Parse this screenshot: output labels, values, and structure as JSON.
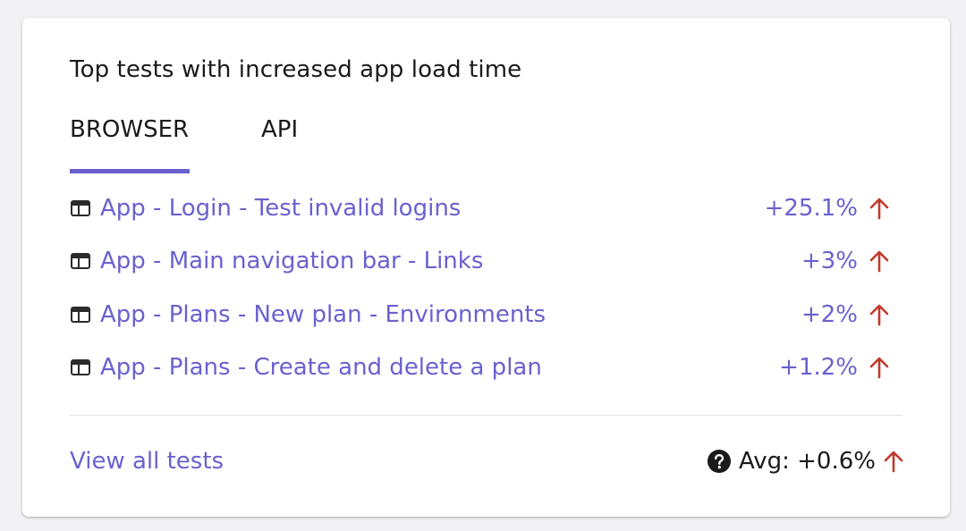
{
  "card": {
    "title": "Top tests with increased app load time",
    "tabs": [
      {
        "label": "BROWSER",
        "active": true
      },
      {
        "label": "API",
        "active": false
      }
    ],
    "rows": [
      {
        "icon": "browser-window-icon",
        "name": "App - Login - Test invalid logins",
        "change": "+25.1%",
        "trend": "up"
      },
      {
        "icon": "browser-window-icon",
        "name": "App - Main navigation bar - Links",
        "change": "+3%",
        "trend": "up"
      },
      {
        "icon": "browser-window-icon",
        "name": "App - Plans - New plan - Environments",
        "change": "+2%",
        "trend": "up"
      },
      {
        "icon": "browser-window-icon",
        "name": "App - Plans - Create and delete a plan",
        "change": "+1.2%",
        "trend": "up"
      }
    ],
    "footer": {
      "view_all_label": "View all tests",
      "avg_label": "Avg: +0.6%",
      "help_icon": "question-circle-icon",
      "trend": "up"
    }
  },
  "colors": {
    "accent": "#6a61cf",
    "increase_arrow": "#c0392b",
    "text": "#1a1a1a",
    "background": "#f2f2f4",
    "card": "#ffffff"
  }
}
